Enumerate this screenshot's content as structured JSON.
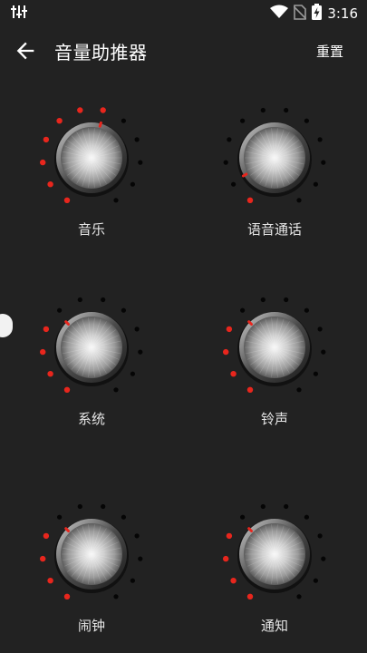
{
  "statusbar": {
    "time": "3:16"
  },
  "appbar": {
    "title": "音量助推器",
    "reset_label": "重置"
  },
  "knobs": [
    {
      "label": "音乐",
      "level": 0.55
    },
    {
      "label": "语音通话",
      "level": 0.1
    },
    {
      "label": "系统",
      "level": 0.35
    },
    {
      "label": "铃声",
      "level": 0.35
    },
    {
      "label": "闹钟",
      "level": 0.35
    },
    {
      "label": "通知",
      "level": 0.35
    }
  ],
  "colors": {
    "background": "#222222",
    "dot_active": "#e8261d",
    "dot_inactive": "#050505"
  },
  "icons": [
    "equalizer-icon",
    "wifi-icon",
    "no-sim-icon",
    "battery-charging-icon",
    "arrow-back-icon"
  ]
}
